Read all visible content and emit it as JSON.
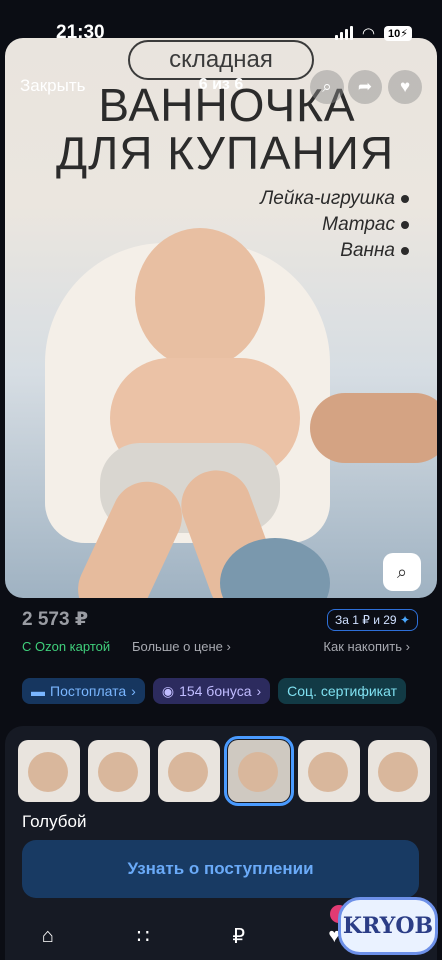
{
  "status_bar": {
    "time": "21:30",
    "battery": "10"
  },
  "header": {
    "close_label": "Закрыть",
    "page_counter": "6 из 6"
  },
  "photo": {
    "title_small": "складная",
    "title_line1": "ВАННОЧКА",
    "title_line2": "ДЛЯ КУПАНИЯ",
    "features": [
      "Лейка-игрушка",
      "Матрас",
      "Ванна"
    ]
  },
  "price_block": {
    "price": "2 573 ₽",
    "ozon_card": "С Ozon картой",
    "more_price": "Больше о цене",
    "installment_label": "За 1 ₽ и 29",
    "save_link": "Как накопить"
  },
  "chips": [
    {
      "label": "Постоплата"
    },
    {
      "label": "154 бонуса"
    },
    {
      "label": "Соц. сертификат"
    }
  ],
  "variants": {
    "selected_index": 3,
    "count": 6,
    "color_label": "Голубой"
  },
  "notify_button": "Узнать о поступлении",
  "tab_bar": [
    "home-icon",
    "catalog-icon",
    "ruble-icon",
    "favorites-icon",
    "cart-icon"
  ],
  "watermark": "KRYOB",
  "colors": {
    "accent_blue": "#4a9bff",
    "ozon_green": "#3fcf7b",
    "button_bg": "#183a63"
  }
}
